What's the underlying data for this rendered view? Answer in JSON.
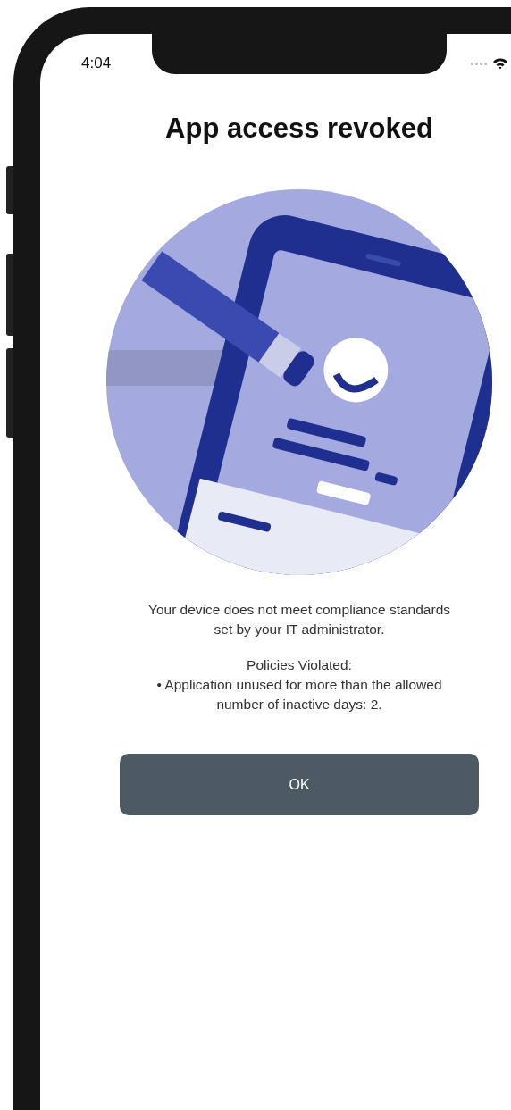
{
  "status_bar": {
    "time": "4:04"
  },
  "title": "App access revoked",
  "message": "Your device does not meet compliance standards set by your IT administrator.",
  "policies": {
    "heading": "Policies Violated:",
    "items": [
      "• Application unused for more than the allowed number of inactive days: 2."
    ]
  },
  "buttons": [
    {
      "label": "OK"
    }
  ]
}
